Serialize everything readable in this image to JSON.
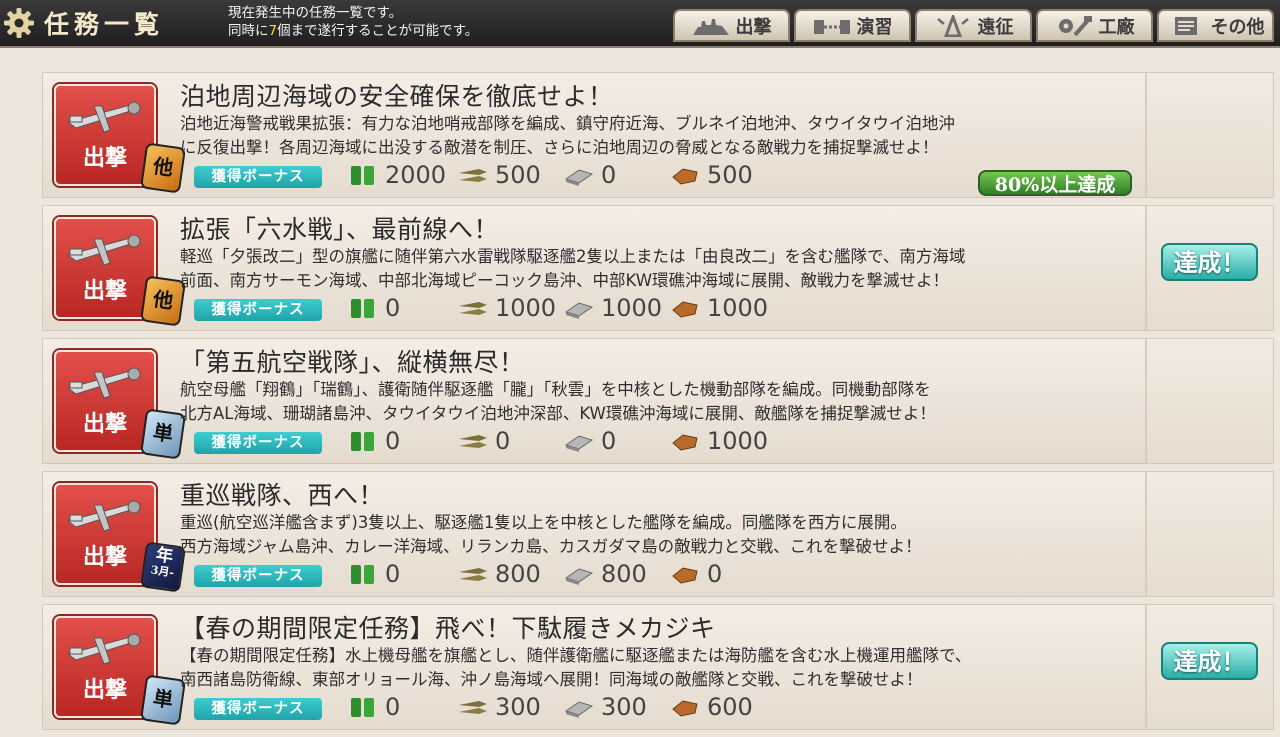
{
  "header": {
    "title": "任務一覧",
    "info_line1": "現在発生中の任務一覧です。",
    "info_line2_pre": "同時に",
    "info_line2_count": "7",
    "info_line2_post": "個まで遂行することが可能です。",
    "tabs": [
      {
        "label": "出撃",
        "icon": "sortie-icon"
      },
      {
        "label": "演習",
        "icon": "exercise-icon"
      },
      {
        "label": "遠征",
        "icon": "expedition-icon"
      },
      {
        "label": "工廠",
        "icon": "arsenal-icon"
      },
      {
        "label": "その他",
        "icon": "other-icon"
      }
    ]
  },
  "bonus_label": "獲得ボーナス",
  "quests": [
    {
      "category": "出撃",
      "frequency": "他",
      "title": "泊地周辺海域の安全確保を徹底せよ！",
      "desc1": "泊地近海警戒戦果拡張：有力な泊地哨戒部隊を編成、鎮守府近海、ブルネイ泊地沖、タウイタウイ泊地沖",
      "desc2": "に反復出撃！各周辺海域に出没する敵潜を制圧、さらに泊地周辺の脅威となる敵戦力を捕捉撃滅せよ！",
      "fuel": "2000",
      "ammo": "500",
      "steel": "0",
      "bauxite": "500",
      "progress": "80%以上達成",
      "status": ""
    },
    {
      "category": "出撃",
      "frequency": "他",
      "title": "拡張「六水戦」、最前線へ！",
      "desc1": "軽巡「夕張改二」型の旗艦に随伴第六水雷戦隊駆逐艦2隻以上または「由良改二」を含む艦隊で、南方海域",
      "desc2": "前面、南方サーモン海域、中部北海域ピーコック島沖、中部KW環礁沖海域に展開、敵戦力を撃滅せよ！",
      "fuel": "0",
      "ammo": "1000",
      "steel": "1000",
      "bauxite": "1000",
      "progress": "",
      "status": "達成！"
    },
    {
      "category": "出撃",
      "frequency": "単",
      "title": "「第五航空戦隊」、縦横無尽！",
      "desc1": "航空母艦「翔鶴」「瑞鶴」、護衛随伴駆逐艦「朧」「秋雲」を中核とした機動部隊を編成。同機動部隊を",
      "desc2": "北方AL海域、珊瑚諸島沖、タウイタウイ泊地沖深部、KW環礁沖海域に展開、敵艦隊を捕捉撃滅せよ！",
      "fuel": "0",
      "ammo": "0",
      "steel": "0",
      "bauxite": "1000",
      "progress": "",
      "status": ""
    },
    {
      "category": "出撃",
      "frequency": "年",
      "frequency_sub": "3月-",
      "title": "重巡戦隊、西へ！",
      "desc1": "重巡(航空巡洋艦含まず)3隻以上、駆逐艦1隻以上を中核とした艦隊を編成。同艦隊を西方に展開。",
      "desc2": "西方海域ジャム島沖、カレー洋海域、リランカ島、カスガダマ島の敵戦力と交戦、これを撃破せよ！",
      "fuel": "0",
      "ammo": "800",
      "steel": "800",
      "bauxite": "0",
      "progress": "",
      "status": ""
    },
    {
      "category": "出撃",
      "frequency": "単",
      "title": "【春の期間限定任務】飛べ！下駄履きメカジキ",
      "desc1": "【春の期間限定任務】水上機母艦を旗艦とし、随伴護衛艦に駆逐艦または海防艦を含む水上機運用艦隊で、",
      "desc2": "南西諸島防衛線、東部オリョール海、沖ノ島海域へ展開！同海域の敵艦隊と交戦、これを撃破せよ！",
      "fuel": "0",
      "ammo": "300",
      "steel": "300",
      "bauxite": "600",
      "progress": "",
      "status": "達成！"
    }
  ]
}
